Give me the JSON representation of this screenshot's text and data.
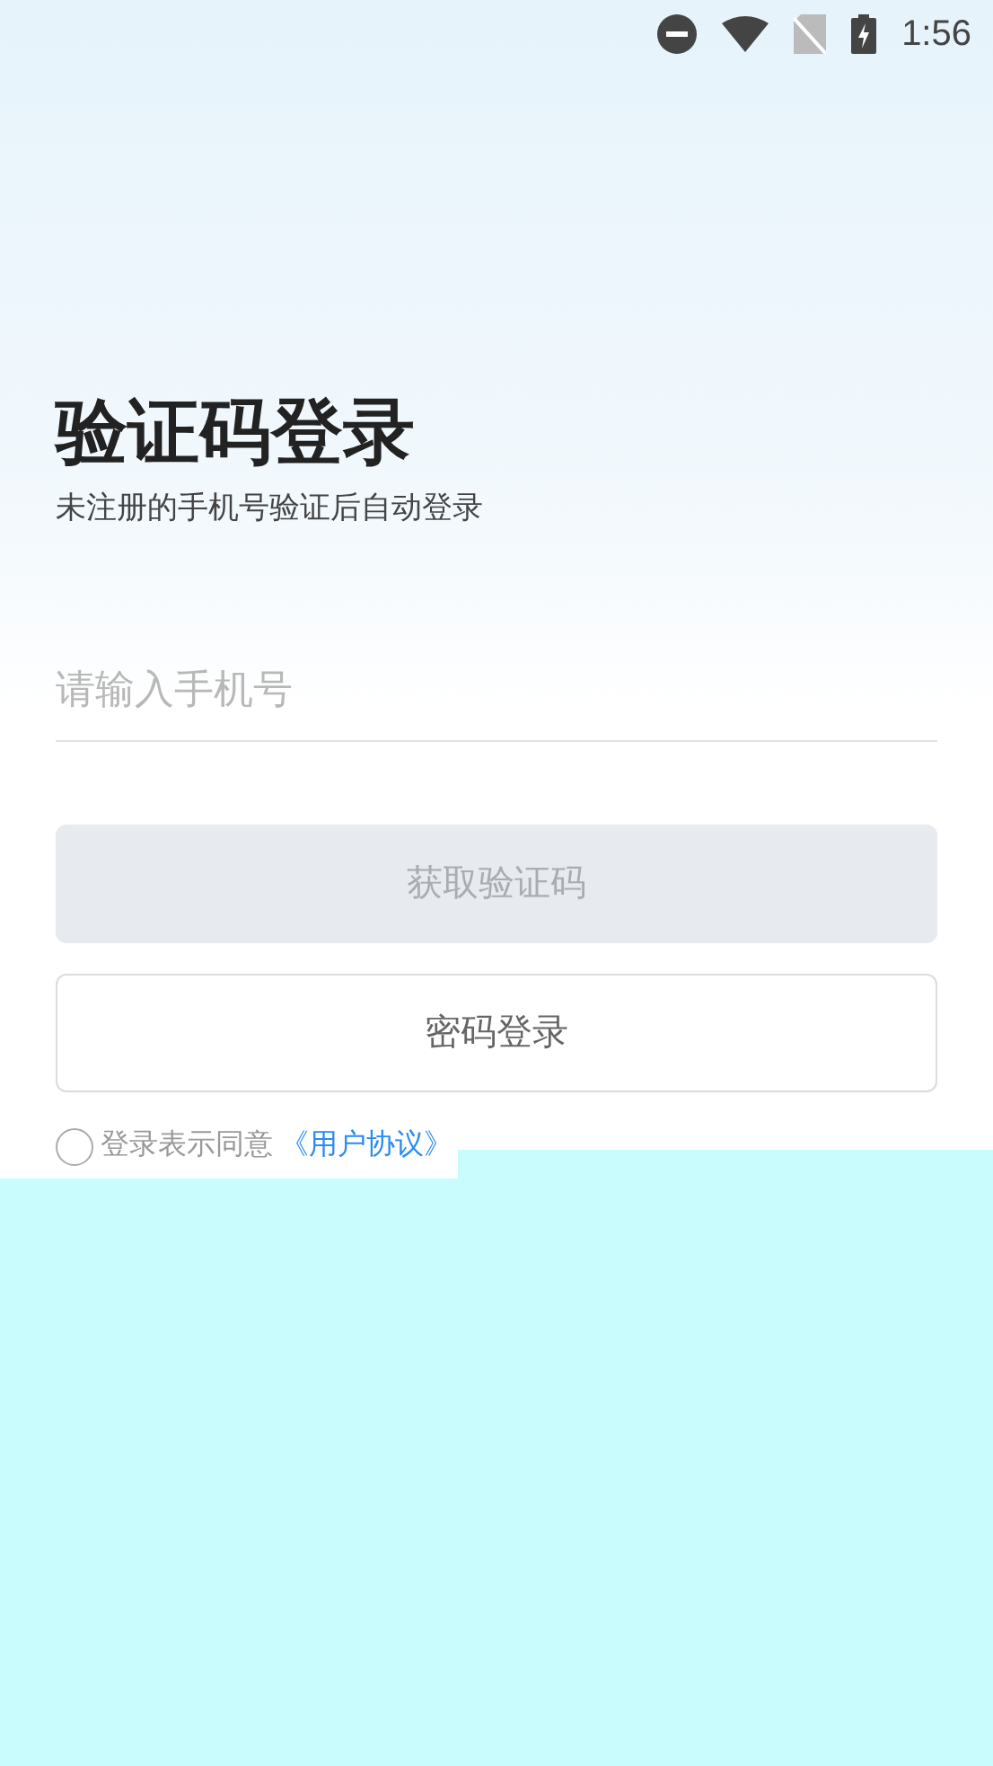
{
  "status_bar": {
    "time": "1:56"
  },
  "title": "验证码登录",
  "subtitle": "未注册的手机号验证后自动登录",
  "phone_field": {
    "placeholder": "请输入手机号"
  },
  "get_code_button": {
    "label": "获取验证码",
    "disabled": true
  },
  "password_login_button": {
    "label": "密码登录"
  },
  "agreement": {
    "checked": false,
    "text": "登录表示同意",
    "link": "《用户协议》"
  }
}
